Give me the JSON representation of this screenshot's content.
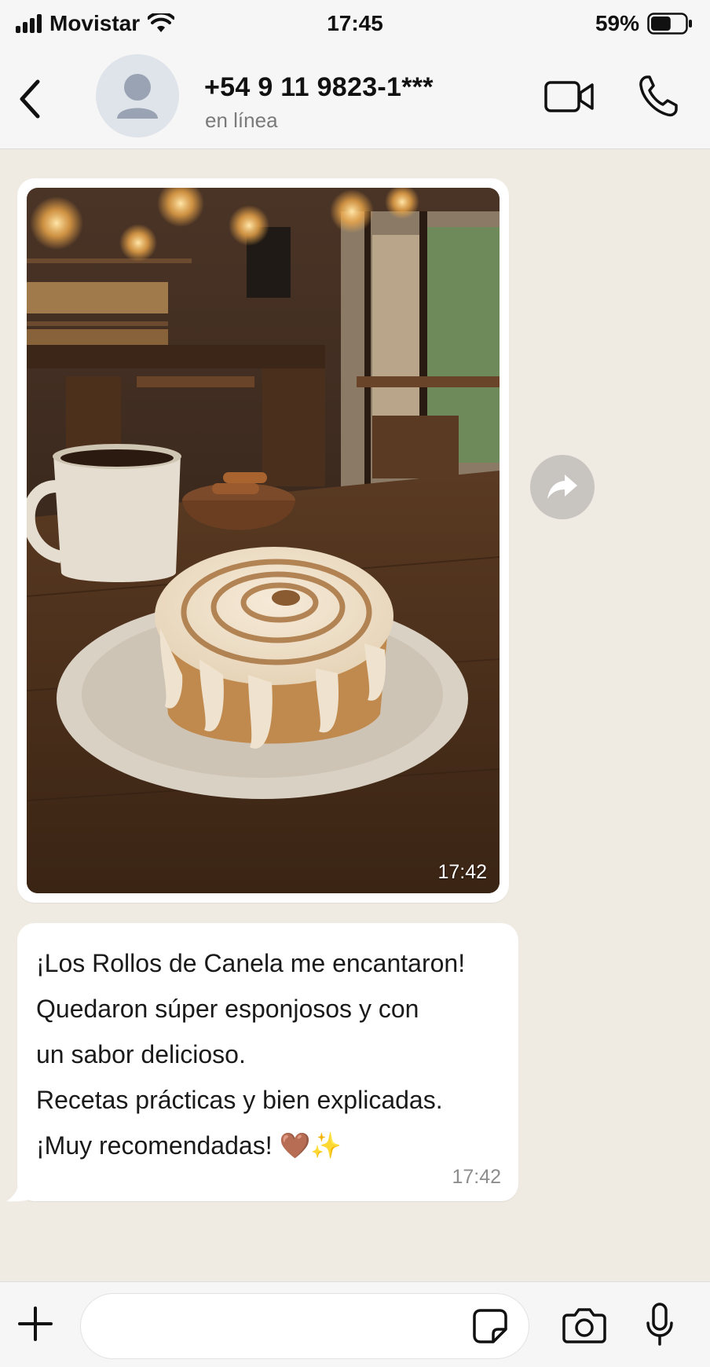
{
  "status_bar": {
    "carrier": "Movistar",
    "time": "17:45",
    "battery": "59%",
    "battery_level": 0.59
  },
  "header": {
    "contact_name": "+54 9 11 9823-1***",
    "contact_status": "en línea",
    "icons": [
      "back-icon",
      "avatar-icon",
      "video-camera-icon",
      "phone-icon"
    ]
  },
  "messages": [
    {
      "type": "image",
      "time": "17:42"
    },
    {
      "type": "text",
      "lines": [
        "¡Los Rollos de Canela me encantaron!",
        "Quedaron súper esponjosos y con",
        "un sabor delicioso.",
        "Recetas prácticas y bien explicadas.",
        "¡Muy recomendadas! 🤎✨"
      ],
      "time": "17:42"
    }
  ],
  "input_bar": {
    "placeholder": "",
    "icons": [
      "plus-icon",
      "sticker-icon",
      "camera-icon",
      "microphone-icon"
    ]
  },
  "colors": {
    "chat_background": "#efeae2",
    "bubble": "#ffffff",
    "header": "#f6f6f6"
  }
}
